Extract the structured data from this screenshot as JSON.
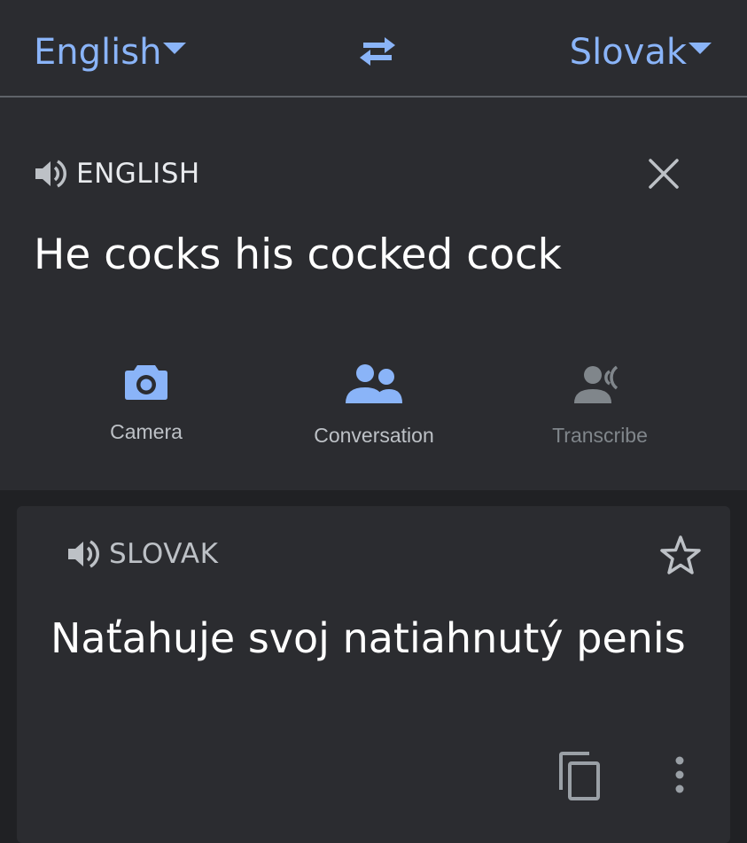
{
  "header": {
    "source_language": "English",
    "target_language": "Slovak"
  },
  "source": {
    "language_label": "ENGLISH",
    "text": "He cocks his cocked cock"
  },
  "tools": [
    {
      "label": "Camera",
      "icon": "camera-icon"
    },
    {
      "label": "Conversation",
      "icon": "people-icon"
    },
    {
      "label": "Transcribe",
      "icon": "transcribe-icon"
    }
  ],
  "target": {
    "language_label": "SLOVAK",
    "text": "Naťahuje svoj natiahnutý penis"
  },
  "colors": {
    "accent": "#8ab4f8",
    "background": "#202124",
    "panel": "#2b2c30",
    "text": "#e8eaed",
    "muted": "#80868b"
  }
}
